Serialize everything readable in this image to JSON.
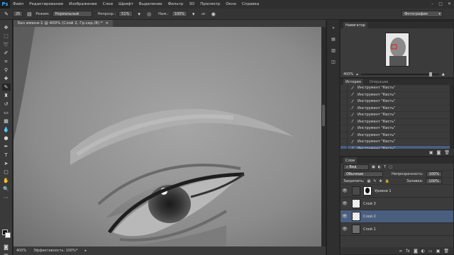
{
  "app": {
    "logo": "Ps"
  },
  "menu": [
    "Файл",
    "Редактирование",
    "Изображение",
    "Слои",
    "Шрифт",
    "Выделение",
    "Фильтр",
    "3D",
    "Просмотр",
    "Окно",
    "Справка"
  ],
  "options": {
    "brush_size": "25",
    "mode_label": "Режим:",
    "mode_value": "Нормальный",
    "opacity_label": "Непрозр.:",
    "opacity_value": "51%",
    "flow_label": "Наж.:",
    "flow_value": "100%",
    "workspace": "Фотография"
  },
  "document": {
    "tab_title": "Без имени-1 @ 400% (Слой 2, Гр.сер./8) *",
    "zoom": "400%",
    "status": "Эффективность: 100%*"
  },
  "navigator": {
    "title": "Навигатор",
    "zoom": "400%"
  },
  "history": {
    "tab_active": "История",
    "tab_other": "Операции",
    "items": [
      "Инструмент \"Кисть\"",
      "Инструмент \"Кисть\"",
      "Инструмент \"Кисть\"",
      "Инструмент \"Кисть\"",
      "Инструмент \"Кисть\"",
      "Инструмент \"Кисть\"",
      "Инструмент \"Кисть\"",
      "Инструмент \"Кисть\"",
      "Инструмент \"Кисть\"",
      "Инструмент \"Кисть\""
    ]
  },
  "layers": {
    "title": "Слои",
    "filter_label": "Вид",
    "blend": "Обычные",
    "opacity_label": "Непрозрачность:",
    "opacity_value": "100%",
    "lock_label": "Закрепить:",
    "fill_label": "Заливка:",
    "fill_value": "100%",
    "items": [
      "Уровни 1",
      "Слой 3",
      "Слой 2",
      "Слой 1"
    ]
  },
  "colors": {
    "accent": "#31a8ff",
    "selection": "#4a5e80"
  }
}
